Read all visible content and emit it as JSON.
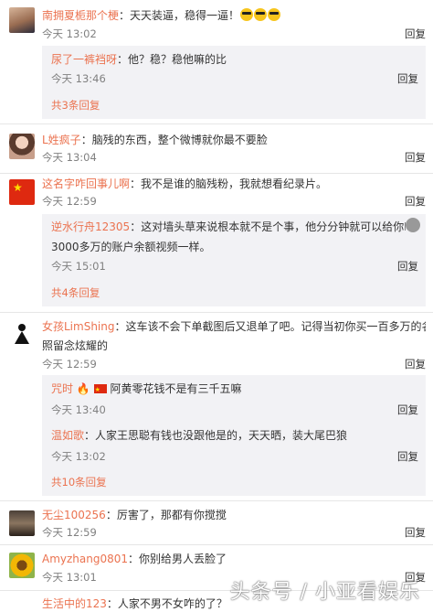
{
  "comments": [
    {
      "name": "南拥夏栀那个梗",
      "text": "：天天装逼，稳得一逼！",
      "time": "今天 13:02",
      "reply": "回复",
      "subs": [
        {
          "name": "尿了一裤裆呀",
          "text": "：他？稳？稳他嘛的比",
          "time": "今天 13:46",
          "reply": "回复"
        }
      ],
      "more": "共3条回复"
    },
    {
      "name": "L姓疯子",
      "text": "：脑残的东西，整个微博就你最不要脸",
      "time": "今天 13:04",
      "reply": "回复"
    },
    {
      "name": "这名字咋回事儿啊",
      "text": "：我不是谁的脑残粉，我就想看纪录片。",
      "time": "今天 12:59",
      "reply": "回复",
      "subs": [
        {
          "name": "逆水行舟12305",
          "text": "：这对墙头草来说根本就不是个事，他分分钟就可以给你P一个就做",
          "text2": "3000多万的账户余额视频一样。",
          "time": "今天 15:01",
          "reply": "回复"
        }
      ],
      "more": "共4条回复"
    },
    {
      "name": "女孩LimShing",
      "text": "：这车该不会下单截图后又退单了吧。记得当初你买一百多万的名表一样",
      "text2": "照留念炫耀的",
      "time": "今天 12:59",
      "reply": "回复",
      "subs": [
        {
          "name": "咒时",
          "text": "阿黄零花钱不是有三千五嘛",
          "time": "今天 13:40",
          "reply": "回复"
        },
        {
          "name": "温如歌",
          "text": "：人家王思聪有钱也没跟他是的，天天晒，装大尾巴狼",
          "time": "今天 13:02",
          "reply": "回复"
        }
      ],
      "more": "共10条回复"
    },
    {
      "name": "无尘100256",
      "text": "：厉害了，那都有你搅搅",
      "time": "今天 12:59",
      "reply": "回复"
    },
    {
      "name": "Amyzhang0801",
      "text": "：你别给男人丢脸了",
      "time": "今天 13:01",
      "reply": "回复"
    },
    {
      "name": "生活中的123",
      "text": "：人家不男不女咋的了？"
    }
  ],
  "watermark": "头条号 / 小亚看娱乐",
  "icons": {
    "emoji": "sunglasses-emoji-icon",
    "flag": "china-flag-icon",
    "fire": "fire-emoji-icon"
  },
  "colors": {
    "name": "#eb7350",
    "time": "#808080",
    "sub_bg": "#f2f2f5"
  }
}
